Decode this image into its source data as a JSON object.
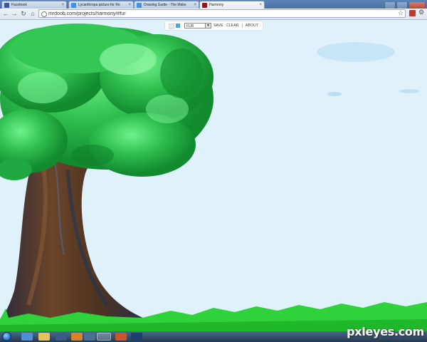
{
  "browser": {
    "tabs": [
      {
        "label": "Facebook",
        "favicon_color": "#3b5998",
        "active": false
      },
      {
        "label": "Lycanthropa picture for Re",
        "favicon_color": "#4a90d9",
        "active": false
      },
      {
        "label": "Drawing Guide - The Make",
        "favicon_color": "#4a90d9",
        "active": false
      },
      {
        "label": "Harmony",
        "favicon_color": "#8b1a1a",
        "active": true
      }
    ],
    "url": "mrdoob.com/projects/harmony/#fur",
    "icons": {
      "back": "back-arrow-icon",
      "forward": "forward-arrow-icon",
      "reload": "reload-icon",
      "home": "home-icon",
      "bookmark": "star-icon",
      "extension": "extension-icon",
      "menu": "wrench-icon"
    }
  },
  "app": {
    "foreground_color": "#e6eaee",
    "background_color": "#4aa6e0",
    "brush": "FUR",
    "menu": {
      "save": "SAVE",
      "clear": "CLEAR",
      "about": "ABOUT"
    }
  },
  "canvas": {
    "sky_color": "#dff1fb",
    "foliage_color": "#2fbf4f",
    "trunk_color": "#5a3a22",
    "grass_color": "#2fd23a"
  },
  "taskbar": {
    "items": [
      "start-orb",
      "ie-icon",
      "folder-icon",
      "media-icon",
      "firefox-icon",
      "chrome-icon",
      "app-icon",
      "app-icon-2",
      "photoshop-icon"
    ]
  },
  "watermark": "pxleyes.com"
}
